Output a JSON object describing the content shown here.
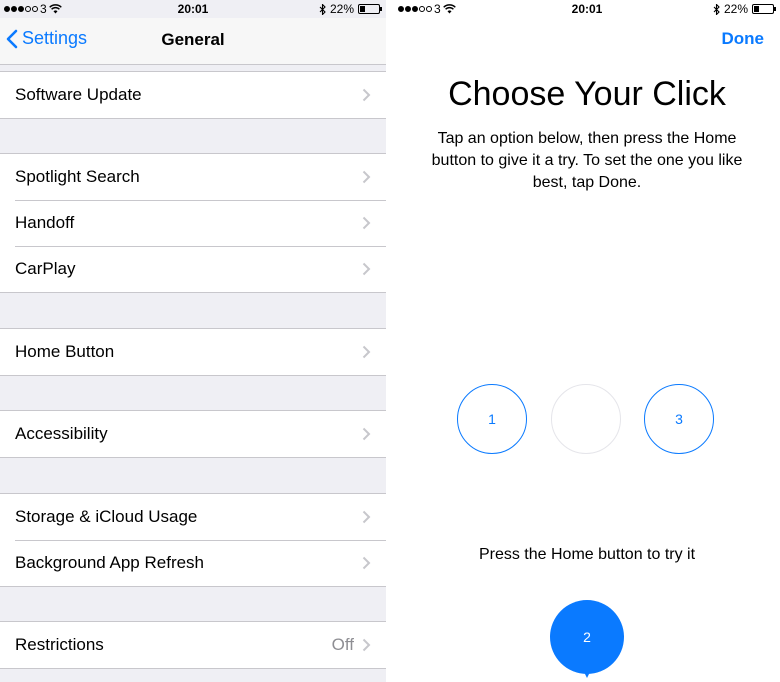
{
  "status_left": {
    "carrier": "3",
    "signal_icon": "signal-dots-icon",
    "wifi_icon": "wifi-icon"
  },
  "status_right": {
    "time": "20:01",
    "battery_percent": "22%",
    "bluetooth_icon": "bluetooth-icon",
    "battery_icon": "battery-icon"
  },
  "settings": {
    "back_label": "Settings",
    "title": "General",
    "groups": [
      [
        {
          "label": "Software Update",
          "value": ""
        }
      ],
      [
        {
          "label": "Spotlight Search",
          "value": ""
        },
        {
          "label": "Handoff",
          "value": ""
        },
        {
          "label": "CarPlay",
          "value": ""
        }
      ],
      [
        {
          "label": "Home Button",
          "value": ""
        }
      ],
      [
        {
          "label": "Accessibility",
          "value": ""
        }
      ],
      [
        {
          "label": "Storage & iCloud Usage",
          "value": ""
        },
        {
          "label": "Background App Refresh",
          "value": ""
        }
      ],
      [
        {
          "label": "Restrictions",
          "value": "Off"
        }
      ]
    ]
  },
  "click_screen": {
    "done_label": "Done",
    "headline": "Choose Your Click",
    "description": "Tap an option below, then press the Home button to give it a try. To set the one you like best, tap Done.",
    "options": [
      "1",
      "",
      "3"
    ],
    "hint": "Press the Home button to try it",
    "selected_option": "2"
  },
  "colors": {
    "accent": "#0a7aff",
    "background_grouped": "#efeff4",
    "separator": "#c8c7cc",
    "secondary_text": "#8e8e93"
  }
}
